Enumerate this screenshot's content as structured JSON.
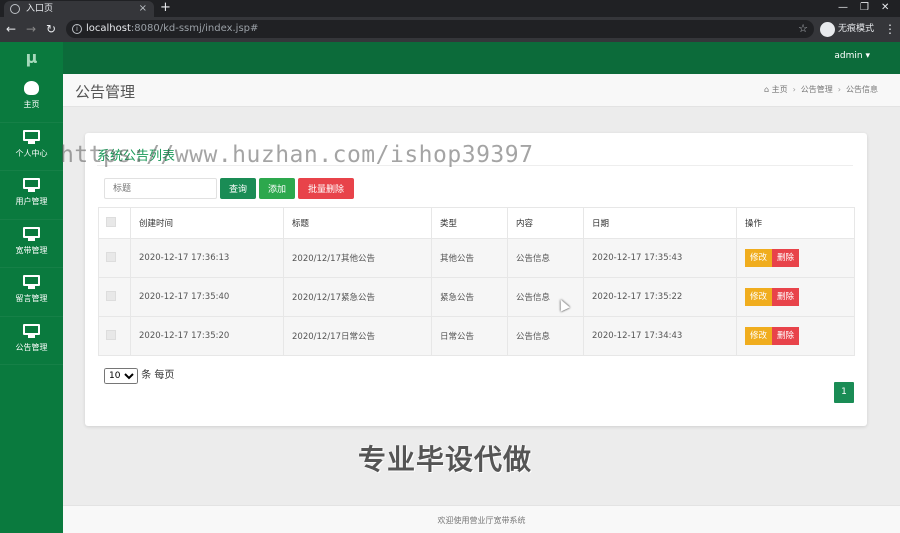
{
  "browser": {
    "tab_title": "入口页",
    "tab_close": "×",
    "new_tab": "+",
    "url_host": "localhost",
    "url_path": ":8080/kd-ssmj/index.jsp#",
    "incognito_label": "无痕模式"
  },
  "sidebar": {
    "logo": "μ",
    "items": [
      {
        "label": "主页",
        "icon": "dashboard-icon"
      },
      {
        "label": "个人中心",
        "icon": "monitor-icon"
      },
      {
        "label": "用户管理",
        "icon": "monitor-icon"
      },
      {
        "label": "宽带管理",
        "icon": "monitor-icon"
      },
      {
        "label": "留言管理",
        "icon": "monitor-icon"
      },
      {
        "label": "公告管理",
        "icon": "monitor-icon"
      }
    ]
  },
  "header": {
    "user": "admin ▾"
  },
  "page": {
    "title": "公告管理",
    "breadcrumb": [
      "主页",
      "公告管理",
      "公告信息"
    ]
  },
  "card": {
    "title": "系统公告列表",
    "search_placeholder": "标题",
    "query_label": "查询",
    "add_label": "添加",
    "batch_delete_label": "批量删除"
  },
  "table": {
    "headers": [
      "创建时间",
      "标题",
      "类型",
      "内容",
      "日期",
      "操作"
    ],
    "rows": [
      {
        "created": "2020-12-17 17:36:13",
        "title": "2020/12/17其他公告",
        "type": "其他公告",
        "content": "公告信息",
        "date": "2020-12-17 17:35:43"
      },
      {
        "created": "2020-12-17 17:35:40",
        "title": "2020/12/17紧急公告",
        "type": "紧急公告",
        "content": "公告信息",
        "date": "2020-12-17 17:35:22"
      },
      {
        "created": "2020-12-17 17:35:20",
        "title": "2020/12/17日常公告",
        "type": "日常公告",
        "content": "公告信息",
        "date": "2020-12-17 17:34:43"
      }
    ],
    "edit_label": "修改",
    "delete_label": "删除"
  },
  "pagination": {
    "page_size": "10",
    "page_size_suffix": "条 每页",
    "current_page": "1"
  },
  "overlay": {
    "watermark": "https://www.huzhan.com/ishop39397",
    "promo": "专业毕设代做"
  },
  "footer": {
    "text": "欢迎使用营业厅宽带系统"
  },
  "colors": {
    "sidebar": "#0a7a3e",
    "topbar": "#0c6b3a",
    "primary": "#1a8c55",
    "danger": "#e8434a",
    "warning": "#f0ad1e"
  }
}
